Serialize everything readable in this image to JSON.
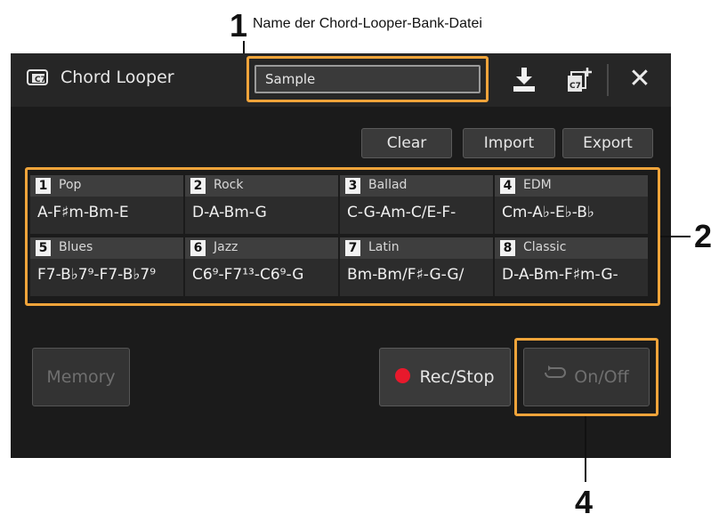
{
  "callouts": {
    "c1_number": "1",
    "c1_text": "Name der Chord-Looper-Bank-Datei",
    "c2_number": "2",
    "c4_number": "4"
  },
  "window": {
    "title": "Chord Looper",
    "bank_file_name": "Sample",
    "icons": [
      "chord-looper-icon",
      "save-icon",
      "new-bank-icon",
      "close-icon"
    ],
    "close_glyph": "✕"
  },
  "buttons": {
    "clear": "Clear",
    "import": "Import",
    "export": "Export",
    "memory": "Memory",
    "rec_stop": "Rec/Stop",
    "on_off": "On/Off"
  },
  "banks": [
    {
      "num": "1",
      "name": "Pop",
      "chords": "A-F♯m-Bm-E"
    },
    {
      "num": "2",
      "name": "Rock",
      "chords": "D-A-Bm-G"
    },
    {
      "num": "3",
      "name": "Ballad",
      "chords": "C-G-Am-C/E-F-"
    },
    {
      "num": "4",
      "name": "EDM",
      "chords": "Cm-A♭-E♭-B♭"
    },
    {
      "num": "5",
      "name": "Blues",
      "chords": "F7-B♭7⁹-F7-B♭7⁹"
    },
    {
      "num": "6",
      "name": "Jazz",
      "chords": "C6⁹-F7¹³-C6⁹-G"
    },
    {
      "num": "7",
      "name": "Latin",
      "chords": "Bm-Bm/F♯-G-G/"
    },
    {
      "num": "8",
      "name": "Classic",
      "chords": "D-A-Bm-F♯m-G-"
    }
  ],
  "colors": {
    "highlight": "#f0a43a",
    "rec_dot": "#e8192c",
    "screen_bg": "#1b1b1b"
  }
}
